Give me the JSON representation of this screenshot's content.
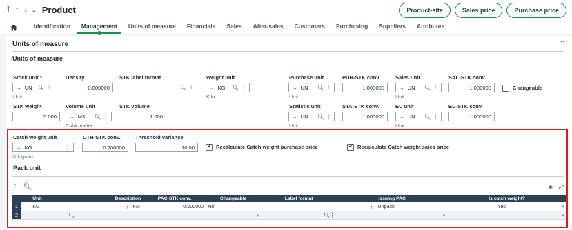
{
  "header": {
    "title": "Product",
    "actions": [
      "Product-site",
      "Sales price",
      "Purchase price"
    ]
  },
  "tabs": [
    "Identification",
    "Management",
    "Units of measure",
    "Financials",
    "Sales",
    "After-sales",
    "Customers",
    "Purchasing",
    "Suppliers",
    "Attributes"
  ],
  "section": {
    "title": "Units of measure",
    "subtitle": "Units of measure"
  },
  "fields": {
    "stock_unit": {
      "label": "Stock unit",
      "value": "UN",
      "sub": "Unit"
    },
    "density": {
      "label": "Density",
      "value": "0.000000"
    },
    "stk_label_format": {
      "label": "STK label format",
      "value": ""
    },
    "weight_unit": {
      "label": "Weight unit",
      "value": "KG",
      "sub": "Kilo"
    },
    "purchase_unit": {
      "label": "Purchase unit",
      "value": "UN",
      "sub": "Unit"
    },
    "pur_stk_conv": {
      "label": "PUR-STK conv.",
      "value": "1.000000"
    },
    "sales_unit": {
      "label": "Sales unit",
      "value": "UN",
      "sub": "Unit"
    },
    "sal_stk_conv": {
      "label": "SAL-STK conv.",
      "value": "1.000000"
    },
    "changeable": {
      "label": "Changeable"
    },
    "stk_weight": {
      "label": "STK weight",
      "value": "5.000"
    },
    "volume_unit": {
      "label": "Volume unit",
      "value": "M3",
      "sub": "Cubic meter"
    },
    "stk_volume": {
      "label": "STK volume",
      "value": "1.000"
    },
    "statistic_unit": {
      "label": "Statistic unit",
      "value": "UN",
      "sub": "Unit"
    },
    "sta_stk_conv": {
      "label": "STA-STK conv.",
      "value": "1.000000"
    },
    "eu_unit": {
      "label": "EU unit",
      "value": "UN",
      "sub": "Unit"
    },
    "eu_stk_conv": {
      "label": "EU-STK conv.",
      "value": "1.000000"
    },
    "catch_weight_unit": {
      "label": "Catch weight unit",
      "value": "KG",
      "sub": "Kilogram"
    },
    "cth_stk_conv": {
      "label": "CTH-STK conv.",
      "value": "0.200000"
    },
    "threshold_variance": {
      "label": "Threshold variance",
      "value": "10.00"
    },
    "recalc_purchase": {
      "label": "Recalculate Catch weight purchase price"
    },
    "recalc_sales": {
      "label": "Recalculate Catch weight sales price"
    }
  },
  "pack_unit": {
    "title": "Pack unit",
    "columns": [
      "Unit",
      "Description",
      "PAC-STK conv.",
      "Changeable",
      "Label format",
      "Issuing PAC",
      "Is catch weight?"
    ],
    "rows": [
      {
        "n": "1",
        "unit": "KG",
        "description": "Kilo",
        "conv": "0.200000",
        "changeable": "No",
        "label_format": "",
        "issuing": "Unpack",
        "catch": "Yes"
      },
      {
        "n": "2",
        "unit": "",
        "description": "",
        "conv": "",
        "changeable": "",
        "label_format": "",
        "issuing": "",
        "catch": ""
      }
    ]
  }
}
